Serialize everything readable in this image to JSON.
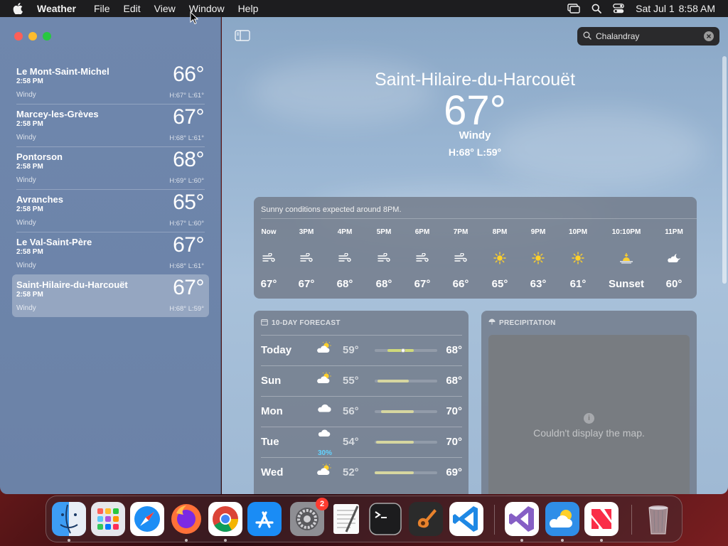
{
  "menubar": {
    "app_name": "Weather",
    "items": [
      "File",
      "Edit",
      "View",
      "Window",
      "Help"
    ],
    "date": "Sat Jul 1",
    "time": "8:58 AM"
  },
  "sidebar": {
    "locations": [
      {
        "name": "Le Mont-Saint-Michel",
        "time": "2:58 PM",
        "condition": "Windy",
        "temp": "66°",
        "hl": "H:67°  L:61°",
        "selected": false
      },
      {
        "name": "Marcey-les-Grèves",
        "time": "2:58 PM",
        "condition": "Windy",
        "temp": "67°",
        "hl": "H:68°  L:61°",
        "selected": false
      },
      {
        "name": "Pontorson",
        "time": "2:58 PM",
        "condition": "Windy",
        "temp": "68°",
        "hl": "H:69°  L:60°",
        "selected": false
      },
      {
        "name": "Avranches",
        "time": "2:58 PM",
        "condition": "Windy",
        "temp": "65°",
        "hl": "H:67°  L:60°",
        "selected": false
      },
      {
        "name": "Le Val-Saint-Père",
        "time": "2:58 PM",
        "condition": "Windy",
        "temp": "67°",
        "hl": "H:68°  L:61°",
        "selected": false
      },
      {
        "name": "Saint-Hilaire-du-Harcouët",
        "time": "2:58 PM",
        "condition": "Windy",
        "temp": "67°",
        "hl": "H:68°  L:59°",
        "selected": true
      }
    ]
  },
  "search": {
    "value": "Chalandray"
  },
  "current": {
    "city": "Saint-Hilaire-du-Harcouët",
    "temp": "67°",
    "condition": "Windy",
    "hl": "H:68°  L:59°"
  },
  "hourly": {
    "summary": "Sunny conditions expected around 8PM.",
    "hours": [
      {
        "time": "Now",
        "icon": "wind-icon",
        "value": "67°"
      },
      {
        "time": "3PM",
        "icon": "wind-icon",
        "value": "67°"
      },
      {
        "time": "4PM",
        "icon": "wind-icon",
        "value": "68°"
      },
      {
        "time": "5PM",
        "icon": "wind-icon",
        "value": "68°"
      },
      {
        "time": "6PM",
        "icon": "wind-icon",
        "value": "67°"
      },
      {
        "time": "7PM",
        "icon": "wind-icon",
        "value": "66°"
      },
      {
        "time": "8PM",
        "icon": "sun-icon",
        "value": "65°"
      },
      {
        "time": "9PM",
        "icon": "sun-icon",
        "value": "63°"
      },
      {
        "time": "10PM",
        "icon": "sun-icon",
        "value": "61°"
      },
      {
        "time": "10:10PM",
        "icon": "sunset-icon",
        "value": "Sunset"
      },
      {
        "time": "11PM",
        "icon": "moon-cloud-icon",
        "value": "60°"
      }
    ]
  },
  "forecast": {
    "title": "10-DAY FORECAST",
    "days": [
      {
        "day": "Today",
        "icon": "partly-sunny-icon",
        "precip": "",
        "low": "59°",
        "high": "68°",
        "bar_start": 0.2,
        "bar_end": 0.62,
        "current": 0.45,
        "bar_color": "#cfd97a"
      },
      {
        "day": "Sun",
        "icon": "partly-sunny-icon",
        "precip": "",
        "low": "55°",
        "high": "68°",
        "bar_start": 0.05,
        "bar_end": 0.55,
        "current": null,
        "bar_color": "#d6d6a0"
      },
      {
        "day": "Mon",
        "icon": "cloud-icon",
        "precip": "",
        "low": "56°",
        "high": "70°",
        "bar_start": 0.1,
        "bar_end": 0.62,
        "current": null,
        "bar_color": "#d6d6a0"
      },
      {
        "day": "Tue",
        "icon": "cloud-rain-icon",
        "precip": "30%",
        "low": "54°",
        "high": "70°",
        "bar_start": 0.02,
        "bar_end": 0.62,
        "current": null,
        "bar_color": "#d6d6a0"
      },
      {
        "day": "Wed",
        "icon": "partly-sunny-icon",
        "precip": "",
        "low": "52°",
        "high": "69°",
        "bar_start": 0.0,
        "bar_end": 0.62,
        "current": null,
        "bar_color": "#d6d6a0"
      }
    ]
  },
  "precipitation": {
    "title": "PRECIPITATION",
    "message": "Couldn't display the map."
  },
  "dock": {
    "apps": [
      {
        "name": "Finder",
        "icon": "finder-icon",
        "running": true
      },
      {
        "name": "Launchpad",
        "icon": "launchpad-icon",
        "running": false
      },
      {
        "name": "Safari",
        "icon": "safari-icon",
        "running": false
      },
      {
        "name": "Firefox",
        "icon": "firefox-icon",
        "running": true
      },
      {
        "name": "Chrome",
        "icon": "chrome-icon",
        "running": true
      },
      {
        "name": "App Store",
        "icon": "app-store-icon",
        "running": false
      },
      {
        "name": "System Settings",
        "icon": "settings-icon",
        "running": false,
        "badge": "2"
      },
      {
        "name": "TextEdit",
        "icon": "textedit-icon",
        "running": false
      },
      {
        "name": "Terminal",
        "icon": "terminal-icon",
        "running": false
      },
      {
        "name": "GarageBand",
        "icon": "garageband-icon",
        "running": false
      },
      {
        "name": "VS Code",
        "icon": "vscode-icon",
        "running": false
      },
      {
        "name": "Visual Studio",
        "icon": "visual-studio-icon",
        "running": true
      },
      {
        "name": "Weather",
        "icon": "weather-icon",
        "running": true
      },
      {
        "name": "News",
        "icon": "news-icon",
        "running": true
      },
      {
        "name": "Trash",
        "icon": "trash-icon",
        "running": false
      }
    ]
  }
}
